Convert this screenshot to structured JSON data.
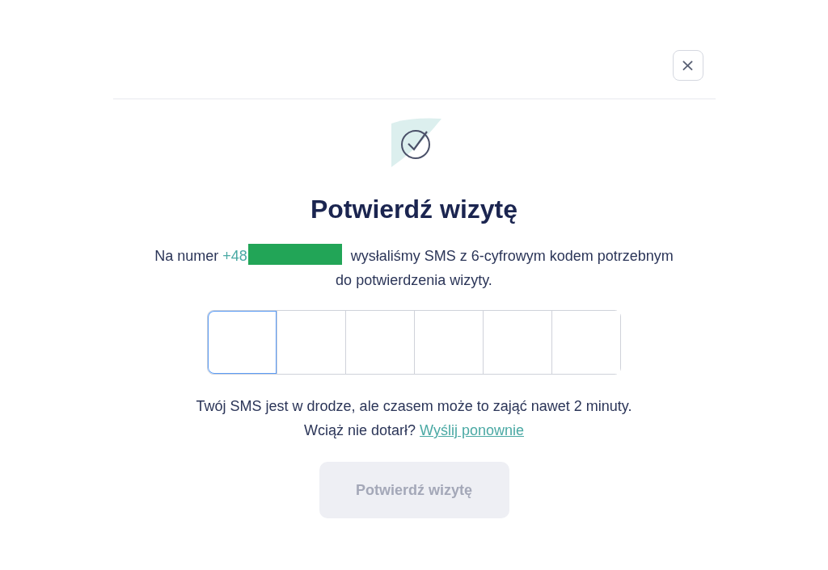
{
  "dialog": {
    "close_label": "×",
    "title": "Potwierdź wizytę",
    "message": {
      "before": "Na numer",
      "phone": "+48",
      "after": "wysłaliśmy SMS z 6-cyfrowym kodem potrzebnym do potwierdzenia wizyty."
    },
    "code_inputs": [
      {
        "focused": true
      },
      {
        "focused": false
      },
      {
        "focused": false
      },
      {
        "focused": false
      },
      {
        "focused": false
      },
      {
        "focused": false
      }
    ],
    "notice": "Twój SMS jest w drodze, ale czasem może to zająć nawet 2 minuty.",
    "resend": {
      "text": "Wciąż nie dotarł?",
      "link": "Wyślij ponownie"
    },
    "submit": {
      "label": "Potwierdź wizytę",
      "disabled": true
    }
  }
}
